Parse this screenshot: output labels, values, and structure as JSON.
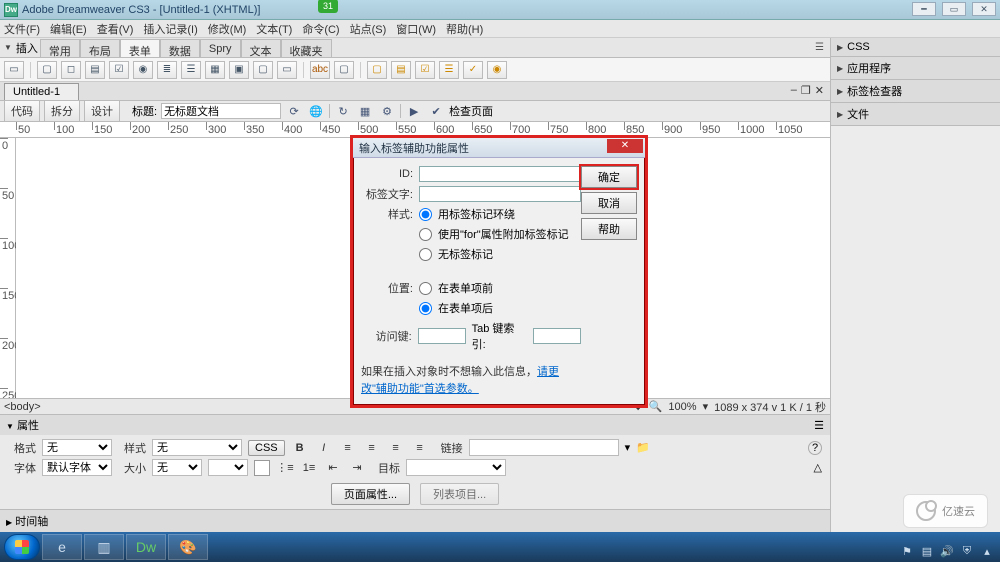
{
  "titlebar": {
    "app": "Adobe Dreamweaver CS3 - [Untitled-1 (XHTML)]",
    "badge": "31"
  },
  "menubar": [
    "文件(F)",
    "编辑(E)",
    "查看(V)",
    "插入记录(I)",
    "修改(M)",
    "文本(T)",
    "命令(C)",
    "站点(S)",
    "窗口(W)",
    "帮助(H)"
  ],
  "insertbar": {
    "label": "插入",
    "tabs": [
      "常用",
      "布局",
      "表单",
      "数据",
      "Spry",
      "文本",
      "收藏夹"
    ],
    "active": 2
  },
  "doc": {
    "tab": "Untitled-1",
    "views": [
      "代码",
      "拆分",
      "设计"
    ],
    "title_label": "标题:",
    "title_value": "无标题文档",
    "check": "检查页面"
  },
  "ruler_h": [
    "50",
    "100",
    "150",
    "200",
    "250",
    "300",
    "350",
    "400",
    "450",
    "500",
    "550",
    "600",
    "650",
    "700",
    "750",
    "800",
    "850",
    "900",
    "950",
    "1000",
    "1050"
  ],
  "ruler_v": [
    "0",
    "50",
    "100",
    "150",
    "200",
    "250"
  ],
  "status": {
    "tag": "<body>",
    "zoom": "100%",
    "dims": "1089 x 374 v 1 K / 1 秒"
  },
  "right_panels": [
    "CSS",
    "应用程序",
    "标签检查器",
    "文件"
  ],
  "prop": {
    "title": "属性",
    "format_label": "格式",
    "format_value": "无",
    "style_label": "样式",
    "style_value": "无",
    "font_label": "字体",
    "font_value": "默认字体",
    "size_label": "大小",
    "size_value": "无",
    "css_btn": "CSS",
    "B": "B",
    "I": "I",
    "link_label": "链接",
    "target_label": "目标",
    "pageprop": "页面属性...",
    "listitem": "列表项目..."
  },
  "timeline": "时间轴",
  "dialog": {
    "title": "输入标签辅助功能属性",
    "id_label": "ID:",
    "text_label": "标签文字:",
    "style_label": "样式:",
    "style_opts": [
      "用标签标记环绕",
      "使用\"for\"属性附加标签标记",
      "无标签标记"
    ],
    "pos_label": "位置:",
    "pos_opts": [
      "在表单项前",
      "在表单项后"
    ],
    "access_label": "访问键:",
    "tab_label": "Tab 键索引:",
    "note_pre": "如果在插入对象时不想输入此信息，",
    "note_link": "请更改\"辅助功能\"首选参数。",
    "ok": "确定",
    "cancel": "取消",
    "help": "帮助"
  },
  "watermark": "亿速云",
  "colors": {
    "red": "#d22"
  }
}
